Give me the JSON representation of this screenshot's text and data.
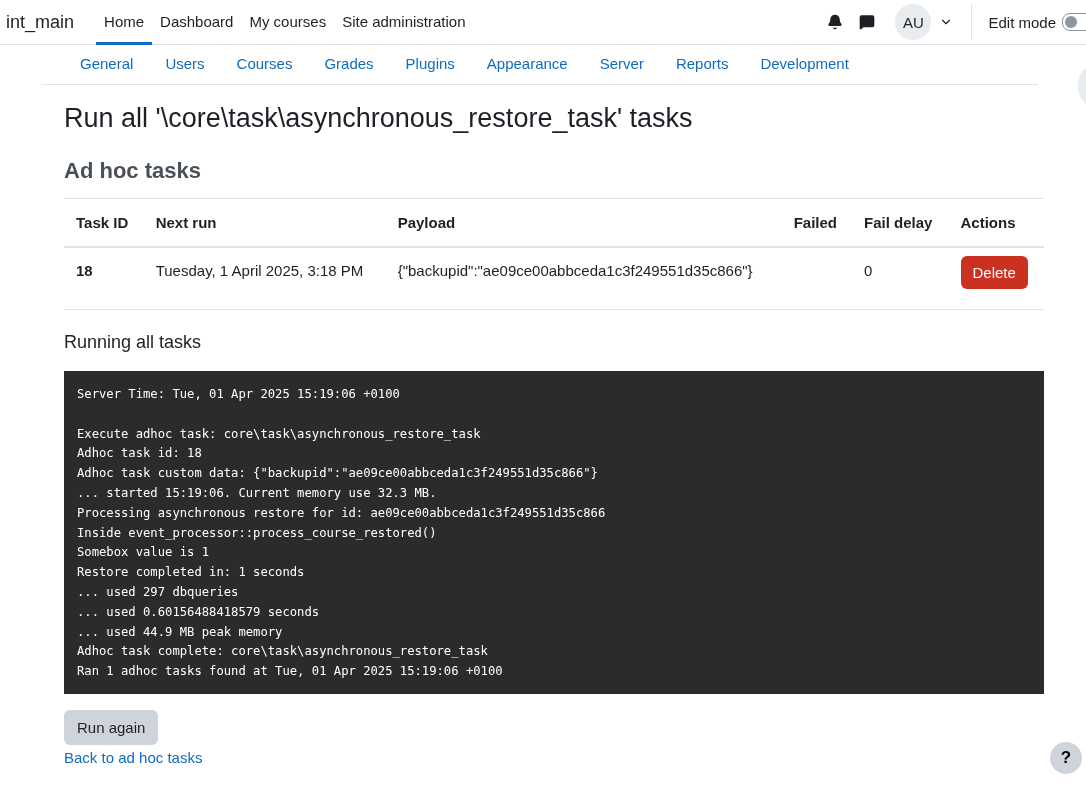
{
  "navbar": {
    "site_name": "int_main",
    "items": [
      {
        "label": "Home",
        "selected": true
      },
      {
        "label": "Dashboard",
        "selected": false
      },
      {
        "label": "My courses",
        "selected": false
      },
      {
        "label": "Site administration",
        "selected": false
      }
    ],
    "avatar": "AU",
    "edit_mode": {
      "label": "Edit mode",
      "on": false
    }
  },
  "admin_tabs": [
    "General",
    "Users",
    "Courses",
    "Grades",
    "Plugins",
    "Appearance",
    "Server",
    "Reports",
    "Development"
  ],
  "page_title": "Run all '\\core\\task\\asynchronous_restore_task' tasks",
  "section_title": "Ad hoc tasks",
  "table": {
    "columns": [
      "Task ID",
      "Next run",
      "Payload",
      "Failed",
      "Fail delay",
      "Actions"
    ],
    "rows": [
      {
        "task_id": "18",
        "next_run": "Tuesday, 1 April 2025, 3:18 PM",
        "payload": "{\"backupid\":\"ae09ce00abbceda1c3f249551d35c866\"}",
        "fail_delay": "0",
        "action": "Delete"
      }
    ]
  },
  "running_heading": "Running all tasks",
  "log": {
    "blocks": [
      [
        "Server Time: Tue, 01 Apr 2025 15:19:06 +0100"
      ],
      [
        "Execute adhoc task: core\\task\\asynchronous_restore_task",
        "Adhoc task id: 18",
        "Adhoc task custom data: {\"backupid\":\"ae09ce00abbceda1c3f249551d35c866\"}",
        "... started 15:19:06. Current memory use 32.3 MB.",
        "Processing asynchronous restore for id: ae09ce00abbceda1c3f249551d35c866",
        "Inside event_processor::process_course_restored()",
        "Somebox value is 1",
        "Restore completed in: 1 seconds",
        "... used 297 dbqueries",
        "... used 0.60156488418579 seconds",
        "... used 44.9 MB peak memory",
        "Adhoc task complete: core\\task\\asynchronous_restore_task",
        "Ran 1 adhoc tasks found at Tue, 01 Apr 2025 15:19:06 +0100"
      ]
    ]
  },
  "run_again_button": "Run again",
  "back_link": "Back to ad hoc tasks",
  "help_button": "?"
}
